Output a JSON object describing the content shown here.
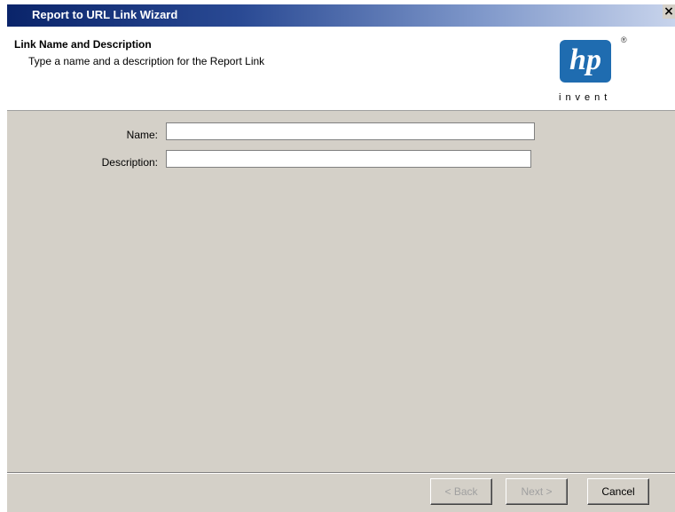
{
  "window": {
    "title": "Report to URL Link Wizard",
    "close_glyph": "✕"
  },
  "header": {
    "title": "Link Name and Description",
    "subtitle": "Type a name and a description for the Report Link",
    "logo": {
      "mark": "hp",
      "registered": "®",
      "tagline": "invent",
      "color": "#1f6cb0"
    }
  },
  "form": {
    "name_label": "Name:",
    "name_value": "",
    "description_label": "Description:",
    "description_value": ""
  },
  "footer": {
    "back_label": "< Back",
    "next_label": "Next >",
    "cancel_label": "Cancel"
  }
}
